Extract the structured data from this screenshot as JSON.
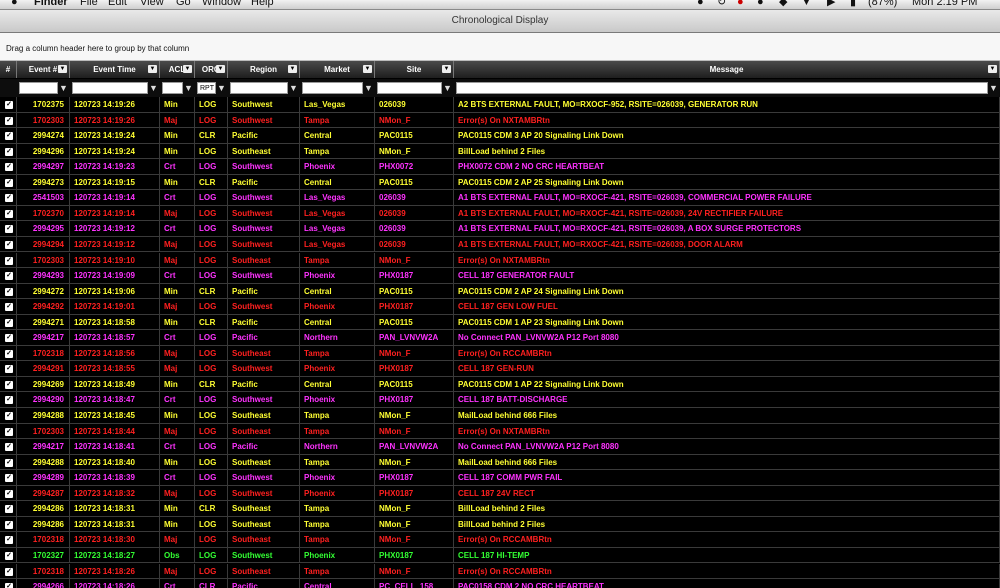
{
  "menubar": {
    "apple": "",
    "items": [
      "Finder",
      "File",
      "Edit",
      "View",
      "Go",
      "Window",
      "Help"
    ],
    "battery": "(87%)",
    "clock": "Mon 2:19 PM"
  },
  "window": {
    "title": "Chronological Display"
  },
  "groupbar": {
    "hint": "Drag a column header here to group by that column"
  },
  "columns": [
    {
      "label": "#"
    },
    {
      "label": "Event #"
    },
    {
      "label": "Event Time"
    },
    {
      "label": "ACL"
    },
    {
      "label": "ORG"
    },
    {
      "label": "Region"
    },
    {
      "label": "Market"
    },
    {
      "label": "Site"
    },
    {
      "label": "Message"
    }
  ],
  "filters": {
    "org_value": "RPT",
    "filter_icon": "funnel-icon"
  },
  "colors": {
    "red": "#ff2020",
    "yellow": "#ffff33",
    "magenta": "#ff33ff",
    "green": "#33ff33"
  },
  "rows": [
    {
      "color": "yellow",
      "event": "1702375",
      "time": "120723 14:19:26",
      "acl": "Min",
      "org": "LOG",
      "region": "Southwest",
      "market": "Las_Vegas",
      "site": "026039",
      "msg": "A2 BTS EXTERNAL FAULT, MO=RXOCF-952, RSITE=026039, GENERATOR RUN"
    },
    {
      "color": "red",
      "event": "1702303",
      "time": "120723 14:19:26",
      "acl": "Maj",
      "org": "LOG",
      "region": "Southwest",
      "market": "Tampa",
      "site": "NMon_F",
      "msg": "Error(s) On NXTAMBRtn"
    },
    {
      "color": "yellow",
      "event": "2994274",
      "time": "120723 14:19:24",
      "acl": "Min",
      "org": "CLR",
      "region": "Pacific",
      "market": "Central",
      "site": "PAC0115",
      "msg": "PAC0115 CDM 3 AP 20 Signaling Link Down"
    },
    {
      "color": "yellow",
      "event": "2994296",
      "time": "120723 14:19:24",
      "acl": "Min",
      "org": "LOG",
      "region": "Southeast",
      "market": "Tampa",
      "site": "NMon_F",
      "msg": "BillLoad behind 2 Files"
    },
    {
      "color": "magenta",
      "event": "2994297",
      "time": "120723 14:19:23",
      "acl": "Crt",
      "org": "LOG",
      "region": "Southwest",
      "market": "Phoenix",
      "site": "PHX0072",
      "msg": "PHX0072 CDM 2 NO CRC HEARTBEAT"
    },
    {
      "color": "yellow",
      "event": "2994273",
      "time": "120723 14:19:15",
      "acl": "Min",
      "org": "CLR",
      "region": "Pacific",
      "market": "Central",
      "site": "PAC0115",
      "msg": "PAC0115 CDM 2 AP 25 Signaling Link Down"
    },
    {
      "color": "magenta",
      "event": "2541503",
      "time": "120723 14:19:14",
      "acl": "Crt",
      "org": "LOG",
      "region": "Southwest",
      "market": "Las_Vegas",
      "site": "026039",
      "msg": "A1 BTS EXTERNAL FAULT, MO=RXOCF-421, RSITE=026039, COMMERCIAL POWER FAILURE"
    },
    {
      "color": "red",
      "event": "1702370",
      "time": "120723 14:19:14",
      "acl": "Maj",
      "org": "LOG",
      "region": "Southwest",
      "market": "Las_Vegas",
      "site": "026039",
      "msg": "A1 BTS EXTERNAL FAULT, MO=RXOCF-421, RSITE=026039, 24V RECTIFIER FAILURE"
    },
    {
      "color": "magenta",
      "event": "2994295",
      "time": "120723 14:19:12",
      "acl": "Crt",
      "org": "LOG",
      "region": "Southwest",
      "market": "Las_Vegas",
      "site": "026039",
      "msg": "A1 BTS EXTERNAL FAULT, MO=RXOCF-421, RSITE=026039, A BOX SURGE PROTECTORS"
    },
    {
      "color": "red",
      "event": "2994294",
      "time": "120723 14:19:12",
      "acl": "Maj",
      "org": "LOG",
      "region": "Southwest",
      "market": "Las_Vegas",
      "site": "026039",
      "msg": "A1 BTS EXTERNAL FAULT, MO=RXOCF-421, RSITE=026039, DOOR ALARM"
    },
    {
      "color": "red",
      "event": "1702303",
      "time": "120723 14:19:10",
      "acl": "Maj",
      "org": "LOG",
      "region": "Southeast",
      "market": "Tampa",
      "site": "NMon_F",
      "msg": "Error(s) On NXTAMBRtn"
    },
    {
      "color": "magenta",
      "event": "2994293",
      "time": "120723 14:19:09",
      "acl": "Crt",
      "org": "LOG",
      "region": "Southwest",
      "market": "Phoenix",
      "site": "PHX0187",
      "msg": "CELL 187 GENERATOR FAULT"
    },
    {
      "color": "yellow",
      "event": "2994272",
      "time": "120723 14:19:06",
      "acl": "Min",
      "org": "CLR",
      "region": "Pacific",
      "market": "Central",
      "site": "PAC0115",
      "msg": "PAC0115 CDM 2 AP 24 Signaling Link Down"
    },
    {
      "color": "red",
      "event": "2994292",
      "time": "120723 14:19:01",
      "acl": "Maj",
      "org": "LOG",
      "region": "Southwest",
      "market": "Phoenix",
      "site": "PHX0187",
      "msg": "CELL 187 GEN LOW FUEL"
    },
    {
      "color": "yellow",
      "event": "2994271",
      "time": "120723 14:18:58",
      "acl": "Min",
      "org": "CLR",
      "region": "Pacific",
      "market": "Central",
      "site": "PAC0115",
      "msg": "PAC0115 CDM 1 AP 23 Signaling Link Down"
    },
    {
      "color": "magenta",
      "event": "2994217",
      "time": "120723 14:18:57",
      "acl": "Crt",
      "org": "LOG",
      "region": "Pacific",
      "market": "Northern",
      "site": "PAN_LVNVW2A",
      "msg": "No Connect PAN_LVNVW2A P12 Port 8080"
    },
    {
      "color": "red",
      "event": "1702318",
      "time": "120723 14:18:56",
      "acl": "Maj",
      "org": "LOG",
      "region": "Southeast",
      "market": "Tampa",
      "site": "NMon_F",
      "msg": "Error(s) On RCCAMBRtn"
    },
    {
      "color": "red",
      "event": "2994291",
      "time": "120723 14:18:55",
      "acl": "Maj",
      "org": "LOG",
      "region": "Southwest",
      "market": "Phoenix",
      "site": "PHX0187",
      "msg": "CELL 187 GEN-RUN"
    },
    {
      "color": "yellow",
      "event": "2994269",
      "time": "120723 14:18:49",
      "acl": "Min",
      "org": "CLR",
      "region": "Pacific",
      "market": "Central",
      "site": "PAC0115",
      "msg": "PAC0115 CDM 1 AP 22 Signaling Link Down"
    },
    {
      "color": "magenta",
      "event": "2994290",
      "time": "120723 14:18:47",
      "acl": "Crt",
      "org": "LOG",
      "region": "Southwest",
      "market": "Phoenix",
      "site": "PHX0187",
      "msg": "CELL 187 BATT-DISCHARGE"
    },
    {
      "color": "yellow",
      "event": "2994288",
      "time": "120723 14:18:45",
      "acl": "Min",
      "org": "LOG",
      "region": "Southeast",
      "market": "Tampa",
      "site": "NMon_F",
      "msg": "MailLoad behind 666 Files"
    },
    {
      "color": "red",
      "event": "1702303",
      "time": "120723 14:18:44",
      "acl": "Maj",
      "org": "LOG",
      "region": "Southeast",
      "market": "Tampa",
      "site": "NMon_F",
      "msg": "Error(s) On NXTAMBRtn"
    },
    {
      "color": "magenta",
      "event": "2994217",
      "time": "120723 14:18:41",
      "acl": "Crt",
      "org": "LOG",
      "region": "Pacific",
      "market": "Northern",
      "site": "PAN_LVNVW2A",
      "msg": "No Connect PAN_LVNVW2A P12 Port 8080"
    },
    {
      "color": "yellow",
      "event": "2994288",
      "time": "120723 14:18:40",
      "acl": "Min",
      "org": "LOG",
      "region": "Southeast",
      "market": "Tampa",
      "site": "NMon_F",
      "msg": "MailLoad behind 666 Files"
    },
    {
      "color": "magenta",
      "event": "2994289",
      "time": "120723 14:18:39",
      "acl": "Crt",
      "org": "LOG",
      "region": "Southwest",
      "market": "Phoenix",
      "site": "PHX0187",
      "msg": "CELL 187 COMM PWR FAIL"
    },
    {
      "color": "red",
      "event": "2994287",
      "time": "120723 14:18:32",
      "acl": "Maj",
      "org": "LOG",
      "region": "Southwest",
      "market": "Phoenix",
      "site": "PHX0187",
      "msg": "CELL 187 24V RECT"
    },
    {
      "color": "yellow",
      "event": "2994286",
      "time": "120723 14:18:31",
      "acl": "Min",
      "org": "CLR",
      "region": "Southeast",
      "market": "Tampa",
      "site": "NMon_F",
      "msg": "BillLoad behind 2 Files"
    },
    {
      "color": "yellow",
      "event": "2994286",
      "time": "120723 14:18:31",
      "acl": "Min",
      "org": "LOG",
      "region": "Southeast",
      "market": "Tampa",
      "site": "NMon_F",
      "msg": "BillLoad behind 2 Files"
    },
    {
      "color": "red",
      "event": "1702318",
      "time": "120723 14:18:30",
      "acl": "Maj",
      "org": "LOG",
      "region": "Southeast",
      "market": "Tampa",
      "site": "NMon_F",
      "msg": "Error(s) On RCCAMBRtn"
    },
    {
      "color": "green",
      "event": "1702327",
      "time": "120723 14:18:27",
      "acl": "Obs",
      "org": "LOG",
      "region": "Southwest",
      "market": "Phoenix",
      "site": "PHX0187",
      "msg": "CELL 187 HI-TEMP"
    },
    {
      "color": "red",
      "event": "1702318",
      "time": "120723 14:18:26",
      "acl": "Maj",
      "org": "LOG",
      "region": "Southeast",
      "market": "Tampa",
      "site": "NMon_F",
      "msg": "Error(s) On RCCAMBRtn"
    },
    {
      "color": "magenta",
      "event": "2994266",
      "time": "120723 14:18:26",
      "acl": "Crt",
      "org": "CLR",
      "region": "Pacific",
      "market": "Central",
      "site": "PC_CELL_158",
      "msg": "PAC0158 CDM 2 NO CRC HEARTBEAT"
    }
  ]
}
